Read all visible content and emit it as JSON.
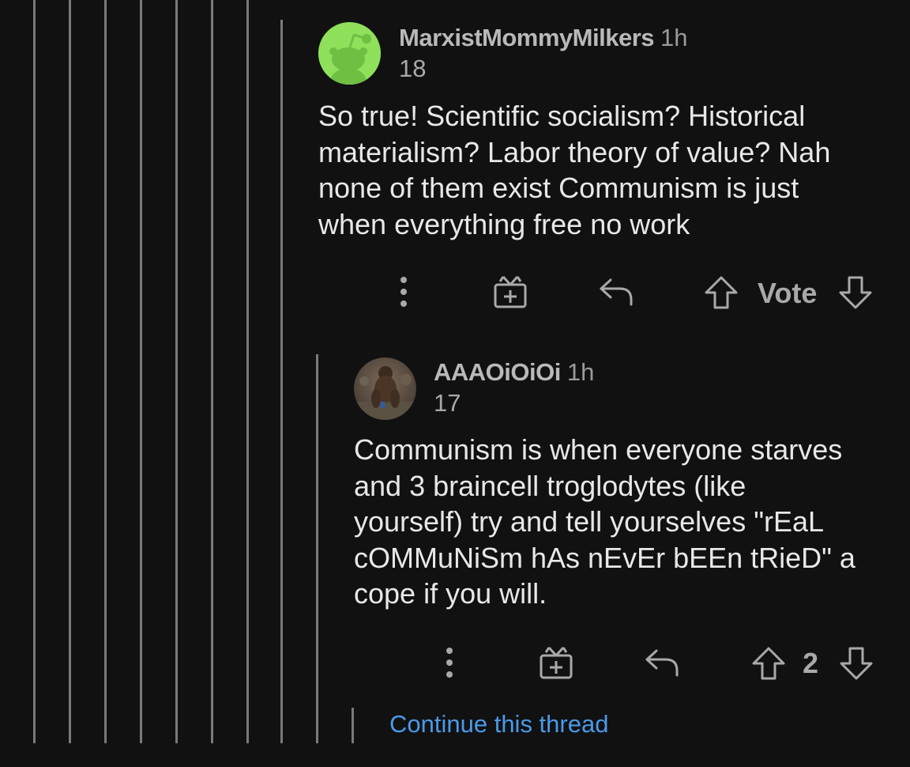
{
  "colors": {
    "background": "#111112",
    "thread_line": "#7a7a7a",
    "username": "#b9b9b9",
    "body_text": "#e8e8e8",
    "icon": "#a9a9a9",
    "link": "#4a9ae8",
    "snoo_avatar_bg": "#8fe05a"
  },
  "comments": [
    {
      "username": "MarxistMommyMilkers",
      "time": "1h",
      "score": "18",
      "avatar_icon": "snoo-avatar-icon",
      "body_lines": [
        "So true! Scientific socialism? Historical",
        "materialism? Labor theory of value? Nah",
        "none of them exist Communism is just",
        "when everything free no work"
      ],
      "actions": {
        "more_icon": "more-vertical-icon",
        "award_icon": "gift-icon",
        "reply_icon": "reply-icon",
        "upvote_icon": "arrow-up-icon",
        "vote_label": "Vote",
        "downvote_icon": "arrow-down-icon"
      }
    },
    {
      "username": "AAAOiOiOi",
      "time": "1h",
      "score": "17",
      "avatar_icon": "photo-avatar-icon",
      "body_lines": [
        "Communism is when everyone starves",
        "and 3 braincell troglodytes (like",
        "yourself) try and tell yourselves \"rEaL",
        "cOMMuNiSm hAs nEvEr bEEn tRieD\" a",
        "cope if you will."
      ],
      "actions": {
        "more_icon": "more-vertical-icon",
        "award_icon": "gift-icon",
        "reply_icon": "reply-icon",
        "upvote_icon": "arrow-up-icon",
        "vote_label": "2",
        "downvote_icon": "arrow-down-icon"
      }
    }
  ],
  "continue_thread": "Continue this thread"
}
